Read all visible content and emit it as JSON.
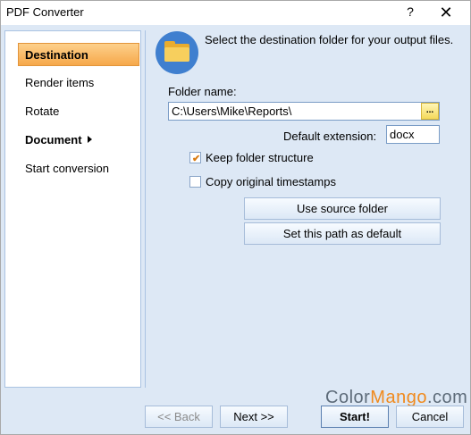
{
  "window": {
    "title": "PDF Converter",
    "help": "?",
    "close": "✕"
  },
  "sidebar": {
    "items": [
      {
        "label": "Destination"
      },
      {
        "label": "Render items"
      },
      {
        "label": "Rotate"
      },
      {
        "label": "Document"
      },
      {
        "label": "Start conversion"
      }
    ]
  },
  "header": {
    "text": "Select the destination folder for your output files."
  },
  "form": {
    "folder_label": "Folder name:",
    "folder_value": "C:\\Users\\Mike\\Reports\\",
    "browse_label": "...",
    "ext_label": "Default extension:",
    "ext_value": "docx",
    "keep_structure": {
      "label": "Keep folder structure",
      "checked": true
    },
    "copy_timestamps": {
      "label": "Copy original timestamps",
      "checked": false
    },
    "use_source": "Use source folder",
    "set_default": "Set this path as default"
  },
  "footer": {
    "back": "<< Back",
    "next": "Next >>",
    "start": "Start!",
    "cancel": "Cancel"
  },
  "watermark": {
    "part1": "Color",
    "part2": "Mango",
    "part3": ".com"
  }
}
